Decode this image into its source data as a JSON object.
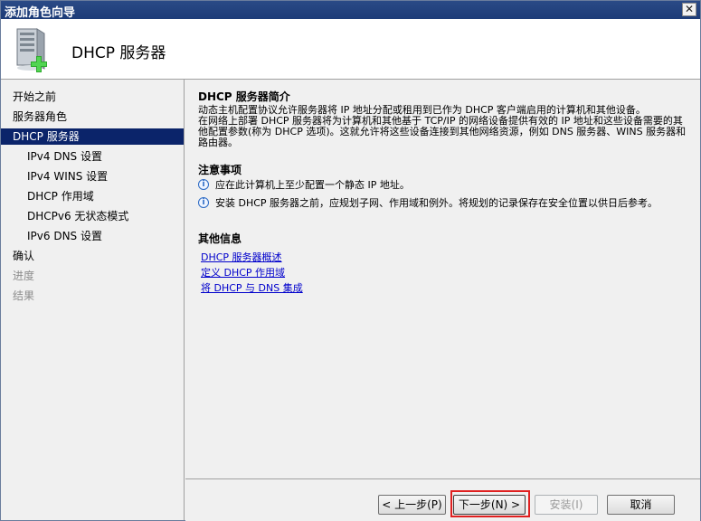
{
  "window": {
    "title": "添加角色向导",
    "close_glyph": "✕"
  },
  "header": {
    "title": "DHCP 服务器",
    "icon": "server-add-icon"
  },
  "sidebar": {
    "items": [
      {
        "label": "开始之前",
        "state": "normal",
        "level": 0
      },
      {
        "label": "服务器角色",
        "state": "normal",
        "level": 0
      },
      {
        "label": "DHCP 服务器",
        "state": "selected",
        "level": 0
      },
      {
        "label": "IPv4 DNS 设置",
        "state": "normal",
        "level": 1
      },
      {
        "label": "IPv4 WINS 设置",
        "state": "normal",
        "level": 1
      },
      {
        "label": "DHCP 作用域",
        "state": "normal",
        "level": 1
      },
      {
        "label": "DHCPv6 无状态模式",
        "state": "normal",
        "level": 1
      },
      {
        "label": "IPv6 DNS 设置",
        "state": "normal",
        "level": 1
      },
      {
        "label": "确认",
        "state": "normal",
        "level": 0
      },
      {
        "label": "进度",
        "state": "disabled",
        "level": 0
      },
      {
        "label": "结果",
        "state": "disabled",
        "level": 0
      }
    ]
  },
  "content": {
    "intro_title": "DHCP 服务器简介",
    "intro_p1": "动态主机配置协议允许服务器将 IP 地址分配或租用到已作为 DHCP 客户端启用的计算机和其他设备。",
    "intro_p2": "在网络上部署 DHCP 服务器将为计算机和其他基于 TCP/IP 的网络设备提供有效的 IP 地址和这些设备需要的其他配置参数(称为 DHCP 选项)。这就允许将这些设备连接到其他网络资源，例如 DNS 服务器、WINS 服务器和路由器。",
    "notes_title": "注意事项",
    "notes": [
      "应在此计算机上至少配置一个静态 IP 地址。",
      "安装 DHCP 服务器之前，应规划子网、作用域和例外。将规划的记录保存在安全位置以供日后参考。"
    ],
    "info_title": "其他信息",
    "links": [
      "DHCP 服务器概述",
      "定义 DHCP 作用域",
      "将 DHCP 与 DNS 集成"
    ]
  },
  "footer": {
    "prev_label": "< 上一步(P)",
    "next_label": "下一步(N) >",
    "install_label": "安装(I)",
    "cancel_label": "取消"
  },
  "colors": {
    "selected_bg": "#0b246a",
    "link": "#0000cc",
    "highlight": "#e02020"
  }
}
